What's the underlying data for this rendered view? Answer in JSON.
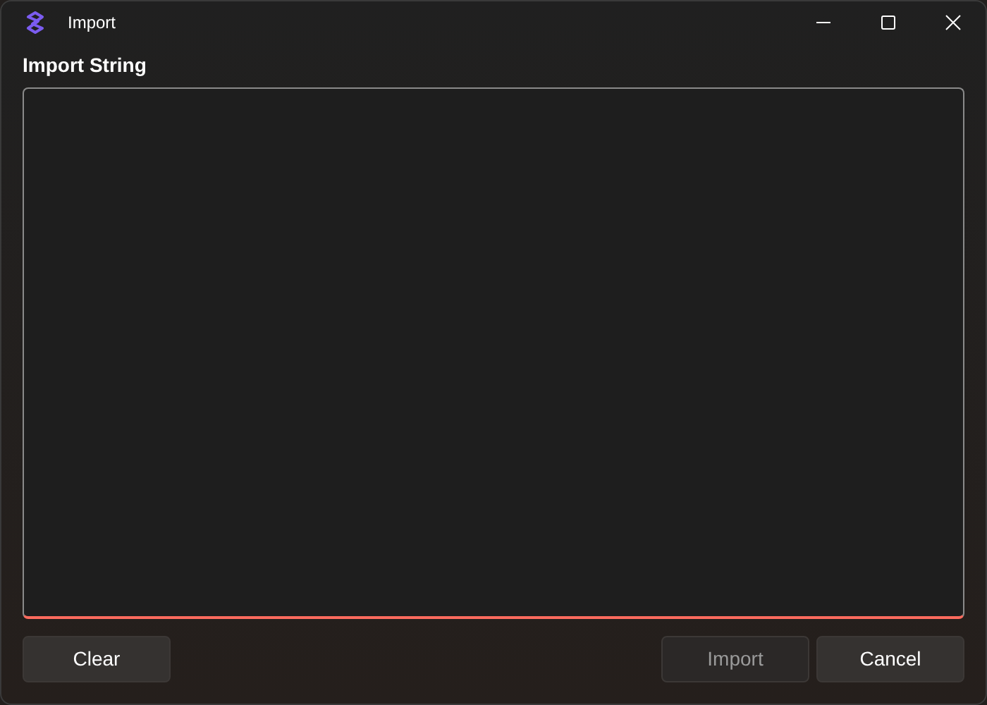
{
  "window": {
    "title": "Import"
  },
  "input": {
    "label": "Import String",
    "invalid": true
  },
  "buttons_left": [
    {
      "label": "Clear",
      "disabled": false
    }
  ],
  "buttons_right": [
    {
      "label": "Import",
      "disabled": true
    },
    {
      "label": "Cancel",
      "disabled": false
    }
  ]
}
